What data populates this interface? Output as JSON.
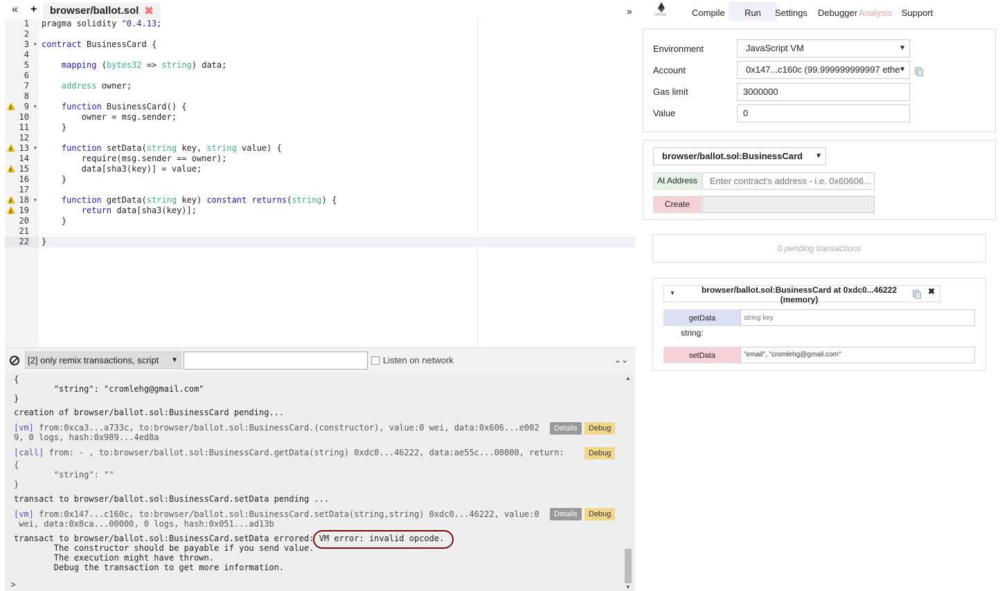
{
  "editor": {
    "tab_title": "browser/ballot.sol",
    "lines": [
      "pragma solidity ^0.4.13;",
      "",
      "contract BusinessCard {",
      "",
      "    mapping (bytes32 => string) data;",
      "",
      "    address owner;",
      "",
      "    function BusinessCard() {",
      "        owner = msg.sender;",
      "    }",
      "",
      "    function setData(string key, string value) {",
      "        require(msg.sender == owner);",
      "        data[sha3(key)] = value;",
      "    }",
      "",
      "    function getData(string key) constant returns(string) {",
      "        return data[sha3(key)];",
      "    }",
      "",
      "}"
    ],
    "warning_lines": [
      9,
      13,
      15,
      18,
      19
    ],
    "fold_lines": [
      3,
      9,
      13,
      18
    ],
    "active_line": 22
  },
  "terminal": {
    "filter_value": "[2] only remix transactions, script",
    "listen_label": "Listen on network",
    "details_label": "Details",
    "debug_label": "Debug",
    "prompt": ">",
    "lines": [
      "{",
      "        \"string\": \"cromlehg@gmail.com\"",
      "}",
      "creation of browser/ballot.sol:BusinessCard pending...",
      "[vm] from:0xca3...a733c, to:browser/ballot.sol:BusinessCard.(constructor), value:0 wei, data:0x606...e002",
      "9, 0 logs, hash:0x989...4ed8a",
      "[call] from: - , to:browser/ballot.sol:BusinessCard.getData(string) 0xdc0...46222, data:ae55c...00000, return:",
      "{",
      "        \"string\": \"\"",
      "}",
      "transact to browser/ballot.sol:BusinessCard.setData pending ...",
      "[vm] from:0x147...c160c, to:browser/ballot.sol:BusinessCard.setData(string,string) 0xdc0...46222, value:0",
      " wei, data:0x8ca...00000, 0 logs, hash:0x051...ad13b",
      "transact to browser/ballot.sol:BusinessCard.setData errored: VM error: invalid opcode.",
      "        The constructor should be payable if you send value.",
      "        The execution might have thrown.",
      "        Debug the transaction to get more information."
    ]
  },
  "right": {
    "logo_text": "remix",
    "tabs": [
      "Compile",
      "Run",
      "Settings",
      "Debugger",
      "Analysis",
      "Support"
    ],
    "environment_label": "Environment",
    "environment_value": "JavaScript VM",
    "account_label": "Account",
    "account_value": "0x147...c160c (99.999999999997 ethe",
    "gas_label": "Gas limit",
    "gas_value": "3000000",
    "value_label": "Value",
    "value_value": "0",
    "contract_select": "browser/ballot.sol:BusinessCard",
    "at_address_label": "At Address",
    "at_address_placeholder": "Enter contract's address - i.e. 0x60606...",
    "create_label": "Create",
    "pending_text": "0 pending transactions",
    "instance_title": "browser/ballot.sol:BusinessCard at 0xdc0...46222 (memory)",
    "getdata_label": "getData",
    "getdata_placeholder": "string key",
    "getdata_result": "string:",
    "setdata_label": "setData",
    "setdata_value": "\"email\", \"cromlehg@gmail.com\""
  },
  "colors": {
    "error_circle": "#7a0a0a",
    "warning": "#e6b800",
    "call_button": "#dde0f5",
    "transact_button": "#f4d2d6",
    "at_address_bg": "#e7f3e4"
  }
}
